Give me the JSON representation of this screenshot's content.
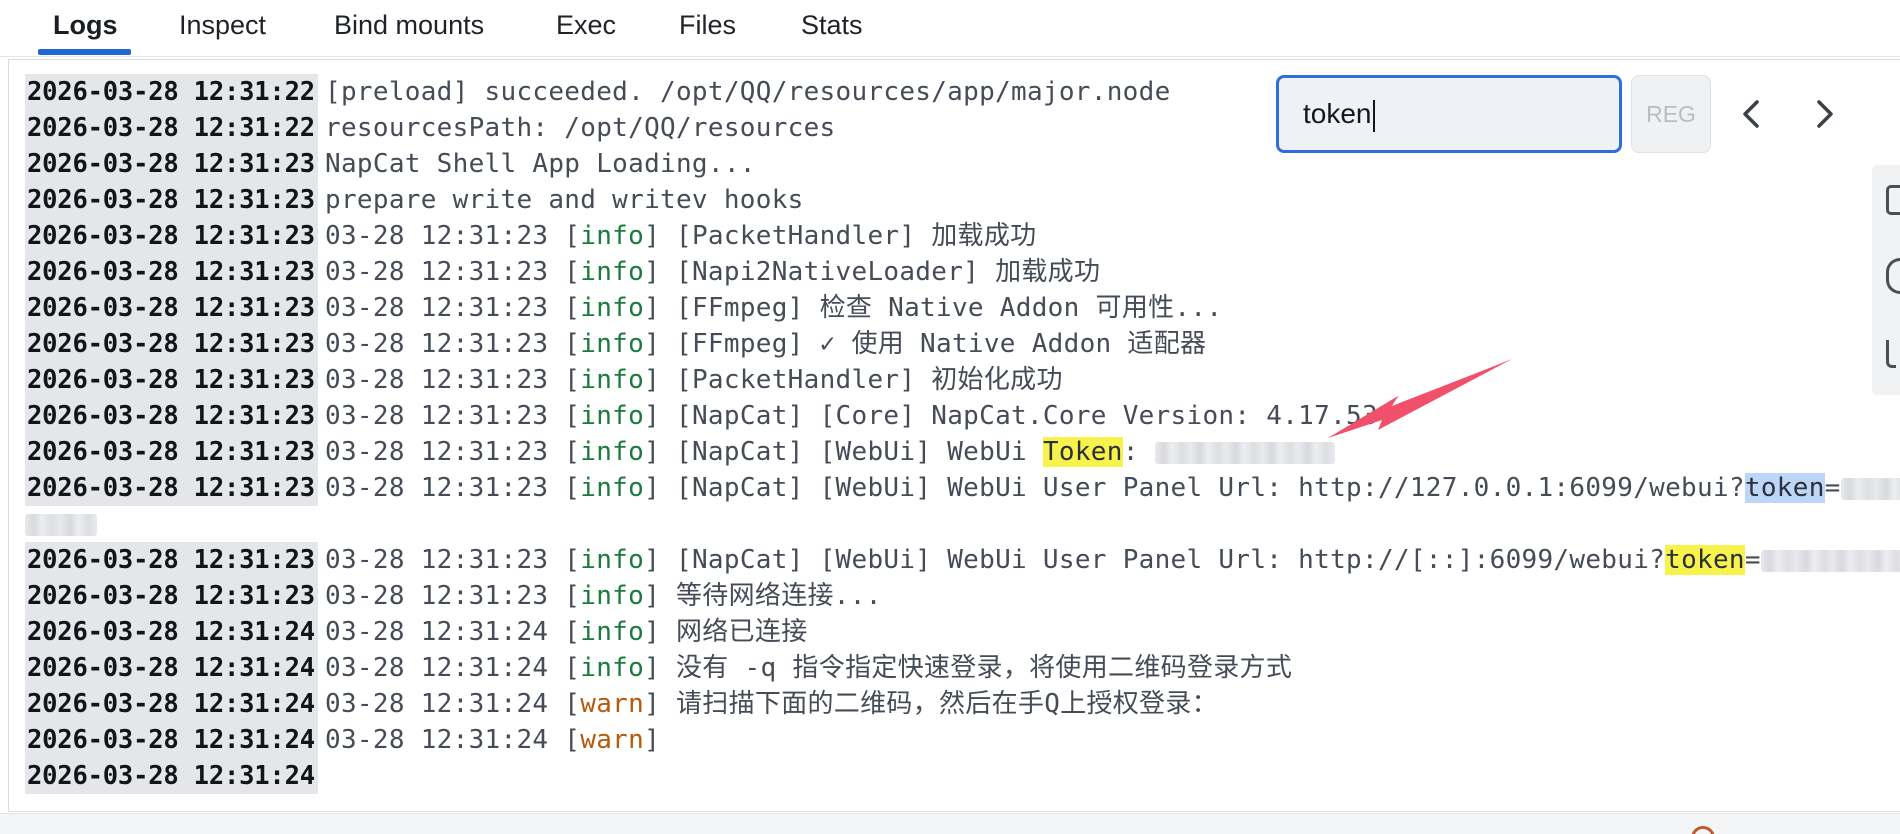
{
  "tabs": [
    {
      "label": "Logs",
      "active": true
    },
    {
      "label": "Inspect"
    },
    {
      "label": "Bind mounts"
    },
    {
      "label": "Exec"
    },
    {
      "label": "Files"
    },
    {
      "label": "Stats"
    }
  ],
  "search": {
    "value": "token",
    "regex_label": "REG",
    "prev_icon": "chevron-left-icon",
    "next_icon": "chevron-right-icon"
  },
  "logs": [
    {
      "ts": "2026-03-28 12:31:22",
      "parts": [
        {
          "t": "[preload] succeeded. /opt/QQ/resources/app/major.node"
        }
      ]
    },
    {
      "ts": "2026-03-28 12:31:22",
      "parts": [
        {
          "t": "resourcesPath: /opt/QQ/resources"
        }
      ]
    },
    {
      "ts": "2026-03-28 12:31:23",
      "parts": [
        {
          "t": "NapCat Shell App Loading..."
        }
      ]
    },
    {
      "ts": "2026-03-28 12:31:23",
      "parts": [
        {
          "t": "prepare write and writev hooks"
        }
      ]
    },
    {
      "ts": "2026-03-28 12:31:23",
      "parts": [
        {
          "t": "03-28 12:31:23 ["
        },
        {
          "t": "info",
          "cls": "lvl-info"
        },
        {
          "t": "] [PacketHandler] 加载成功"
        }
      ]
    },
    {
      "ts": "2026-03-28 12:31:23",
      "parts": [
        {
          "t": "03-28 12:31:23 ["
        },
        {
          "t": "info",
          "cls": "lvl-info"
        },
        {
          "t": "] [Napi2NativeLoader] 加载成功"
        }
      ]
    },
    {
      "ts": "2026-03-28 12:31:23",
      "parts": [
        {
          "t": "03-28 12:31:23 ["
        },
        {
          "t": "info",
          "cls": "lvl-info"
        },
        {
          "t": "] [FFmpeg] 检查 Native Addon 可用性..."
        }
      ]
    },
    {
      "ts": "2026-03-28 12:31:23",
      "parts": [
        {
          "t": "03-28 12:31:23 ["
        },
        {
          "t": "info",
          "cls": "lvl-info"
        },
        {
          "t": "] [FFmpeg] ✓ 使用 Native Addon 适配器"
        }
      ]
    },
    {
      "ts": "2026-03-28 12:31:23",
      "parts": [
        {
          "t": "03-28 12:31:23 ["
        },
        {
          "t": "info",
          "cls": "lvl-info"
        },
        {
          "t": "] [PacketHandler] 初始化成功"
        }
      ]
    },
    {
      "ts": "2026-03-28 12:31:23",
      "parts": [
        {
          "t": "03-28 12:31:23 ["
        },
        {
          "t": "info",
          "cls": "lvl-info"
        },
        {
          "t": "] [NapCat] [Core] NapCat.Core Version: 4.17.53"
        }
      ]
    },
    {
      "ts": "2026-03-28 12:31:23",
      "parts": [
        {
          "t": "03-28 12:31:23 ["
        },
        {
          "t": "info",
          "cls": "lvl-info"
        },
        {
          "t": "] [NapCat] [WebUi] WebUi "
        },
        {
          "t": "Token",
          "cls": "hl-y"
        },
        {
          "t": ": "
        },
        {
          "blur": 180
        }
      ]
    },
    {
      "ts": "2026-03-28 12:31:23",
      "parts": [
        {
          "t": "03-28 12:31:23 ["
        },
        {
          "t": "info",
          "cls": "lvl-info"
        },
        {
          "t": "] [NapCat] [WebUi] WebUi User Panel Url: http://127.0.0.1:6099/webui?"
        },
        {
          "t": "token",
          "cls": "hl-b"
        },
        {
          "t": "="
        },
        {
          "blur": 115
        }
      ]
    },
    {
      "wrap": true,
      "parts": [
        {
          "blur": 72
        }
      ]
    },
    {
      "ts": "2026-03-28 12:31:23",
      "parts": [
        {
          "t": "03-28 12:31:23 ["
        },
        {
          "t": "info",
          "cls": "lvl-info"
        },
        {
          "t": "] [NapCat] [WebUi] WebUi User Panel Url: http://[::]:6099/webui?"
        },
        {
          "t": "token",
          "cls": "hl-y"
        },
        {
          "t": "="
        },
        {
          "blur": 180
        }
      ]
    },
    {
      "ts": "2026-03-28 12:31:23",
      "parts": [
        {
          "t": "03-28 12:31:23 ["
        },
        {
          "t": "info",
          "cls": "lvl-info"
        },
        {
          "t": "] 等待网络连接..."
        }
      ]
    },
    {
      "ts": "2026-03-28 12:31:24",
      "parts": [
        {
          "t": "03-28 12:31:24 ["
        },
        {
          "t": "info",
          "cls": "lvl-info"
        },
        {
          "t": "] 网络已连接"
        }
      ]
    },
    {
      "ts": "2026-03-28 12:31:24",
      "parts": [
        {
          "t": "03-28 12:31:24 ["
        },
        {
          "t": "info",
          "cls": "lvl-info"
        },
        {
          "t": "] 没有 -q 指令指定快速登录，将使用二维码登录方式"
        }
      ]
    },
    {
      "ts": "2026-03-28 12:31:24",
      "parts": [
        {
          "t": "03-28 12:31:24 ["
        },
        {
          "t": "warn",
          "cls": "lvl-warn"
        },
        {
          "t": "] 请扫描下面的二维码，然后在手Q上授权登录："
        }
      ]
    },
    {
      "ts": "2026-03-28 12:31:24",
      "parts": [
        {
          "t": "03-28 12:31:24 ["
        },
        {
          "t": "warn",
          "cls": "lvl-warn"
        },
        {
          "t": "]"
        }
      ]
    },
    {
      "ts": "2026-03-28 12:31:24",
      "parts": []
    }
  ],
  "colors": {
    "accent": "#1f66d1",
    "info": "#1c7a3e",
    "warn": "#b65a0e",
    "highlight_match": "#f8f34c",
    "highlight_current": "#bcd6f7",
    "annotation_arrow": "#f0506a"
  }
}
